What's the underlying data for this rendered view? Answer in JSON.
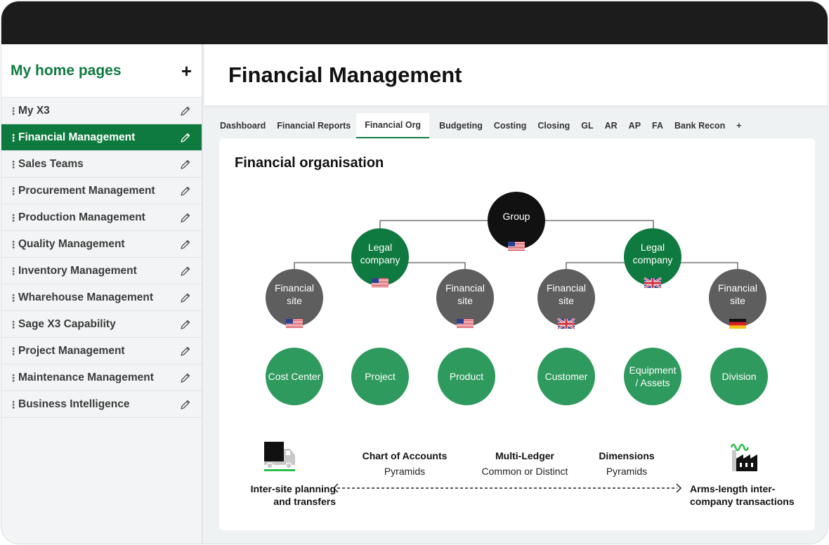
{
  "sidebar": {
    "title": "My home pages",
    "add_label": "+",
    "items": [
      {
        "label": "My X3",
        "active": false
      },
      {
        "label": "Financial Management",
        "active": true
      },
      {
        "label": "Sales Teams",
        "active": false
      },
      {
        "label": "Procurement Management",
        "active": false
      },
      {
        "label": "Production Management",
        "active": false
      },
      {
        "label": "Quality Management",
        "active": false
      },
      {
        "label": "Inventory Management",
        "active": false
      },
      {
        "label": "Wharehouse Management",
        "active": false
      },
      {
        "label": "Sage X3 Capability",
        "active": false
      },
      {
        "label": "Project Management",
        "active": false
      },
      {
        "label": "Maintenance Management",
        "active": false
      },
      {
        "label": "Business Intelligence",
        "active": false
      }
    ]
  },
  "page": {
    "title": "Financial Management"
  },
  "tabs": [
    {
      "label": "Dashboard"
    },
    {
      "label": "Financial Reports"
    },
    {
      "label": "Financial Org",
      "active": true
    },
    {
      "label": "Budgeting"
    },
    {
      "label": "Costing"
    },
    {
      "label": "Closing"
    },
    {
      "label": "GL"
    },
    {
      "label": "AR"
    },
    {
      "label": "AP"
    },
    {
      "label": "FA"
    },
    {
      "label": "Bank Recon"
    },
    {
      "label": "+"
    }
  ],
  "diagram": {
    "title": "Financial organisation",
    "nodes": {
      "group": {
        "lines": [
          "Group"
        ],
        "flag": "us"
      },
      "legal_1": {
        "lines": [
          "Legal",
          "company"
        ],
        "flag": "us"
      },
      "legal_2": {
        "lines": [
          "Legal",
          "company"
        ],
        "flag": "uk"
      },
      "site_1": {
        "lines": [
          "Financial",
          "site"
        ],
        "flag": "us"
      },
      "site_2": {
        "lines": [
          "Financial",
          "site"
        ],
        "flag": "us"
      },
      "site_3": {
        "lines": [
          "Financial",
          "site"
        ],
        "flag": "uk"
      },
      "site_4": {
        "lines": [
          "Financial",
          "site"
        ],
        "flag": "de"
      }
    },
    "dimensions": [
      {
        "lines": [
          "Cost Center"
        ]
      },
      {
        "lines": [
          "Project"
        ]
      },
      {
        "lines": [
          "Product"
        ]
      },
      {
        "lines": [
          "Customer"
        ]
      },
      {
        "lines": [
          "Equipment",
          "/ Assets"
        ]
      },
      {
        "lines": [
          "Division"
        ]
      }
    ],
    "colors": {
      "group": "#111111",
      "legal": "#0f7a3f",
      "site": "#5e5e5e",
      "dimension": "#2e9a5e",
      "connector": "#777777"
    }
  },
  "bottom": {
    "features": [
      {
        "title": "Chart of Accounts",
        "sub": "Pyramids"
      },
      {
        "title": "Multi-Ledger",
        "sub": "Common or Distinct"
      },
      {
        "title": "Dimensions",
        "sub": "Pyramids"
      }
    ],
    "left_caption": [
      "Inter-site planning",
      "and transfers"
    ],
    "right_caption": [
      "Arms-length inter-",
      "company transactions"
    ],
    "left_icon": "truck-icon",
    "right_icon": "factory-icon"
  }
}
